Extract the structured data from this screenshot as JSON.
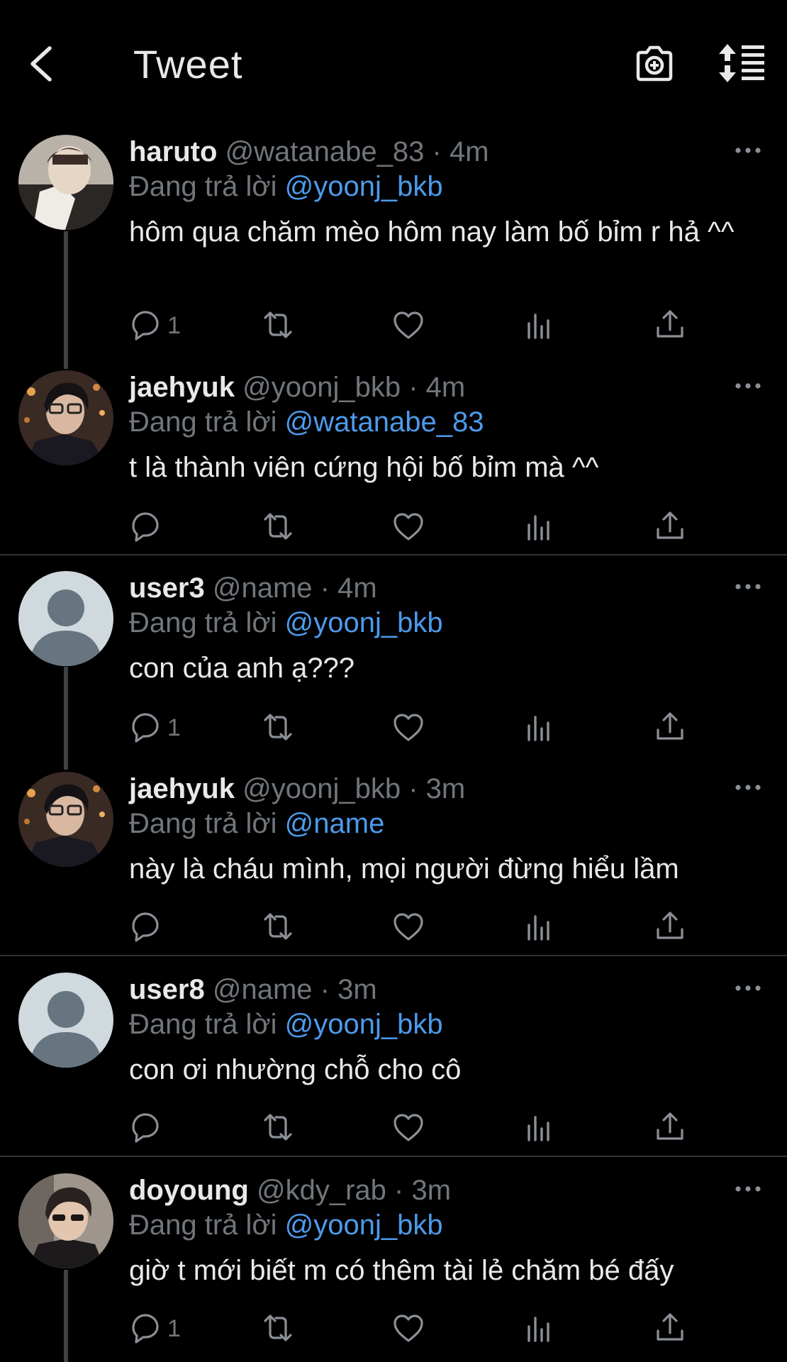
{
  "header": {
    "title": "Tweet",
    "icons": [
      "back-arrow-icon",
      "camera-plus-icon",
      "sort-list-icon"
    ]
  },
  "colors": {
    "background": "#000000",
    "text": "#e7e9ea",
    "muted": "#71767b",
    "link": "#4d9aeb",
    "divider": "#2f3336",
    "thread_line": "#3e4144"
  },
  "reply_label": "Đang trả lời",
  "tweets": [
    {
      "name": "haruto",
      "handle": "@watanabe_83",
      "time": "· 4m",
      "reply_to": "@yoonj_bkb",
      "text": "hôm qua chăm mèo hôm nay làm bố bỉm r hả ^^",
      "reply_count": "1",
      "avatar": "photo"
    },
    {
      "name": "jaehyuk",
      "handle": "@yoonj_bkb",
      "time": "· 4m",
      "reply_to": "@watanabe_83",
      "text": "t là thành viên cứng hội bố bỉm mà ^^",
      "reply_count": "",
      "avatar": "photo"
    },
    {
      "name": "user3",
      "handle": "@name",
      "time": "· 4m",
      "reply_to": "@yoonj_bkb",
      "text": "con của anh ạ???",
      "reply_count": "1",
      "avatar": "default"
    },
    {
      "name": "jaehyuk",
      "handle": "@yoonj_bkb",
      "time": "· 3m",
      "reply_to": "@name",
      "text": "này là cháu mình, mọi người đừng hiểu lầm",
      "reply_count": "",
      "avatar": "photo"
    },
    {
      "name": "user8",
      "handle": "@name",
      "time": "· 3m",
      "reply_to": "@yoonj_bkb",
      "text": "con ơi nhường chỗ cho cô",
      "reply_count": "",
      "avatar": "default"
    },
    {
      "name": "doyoung",
      "handle": "@kdy_rab",
      "time": "· 3m",
      "reply_to": "@yoonj_bkb",
      "text": "giờ t mới biết m có thêm tài lẻ chăm bé đấy",
      "reply_count": "1",
      "avatar": "photo"
    }
  ]
}
